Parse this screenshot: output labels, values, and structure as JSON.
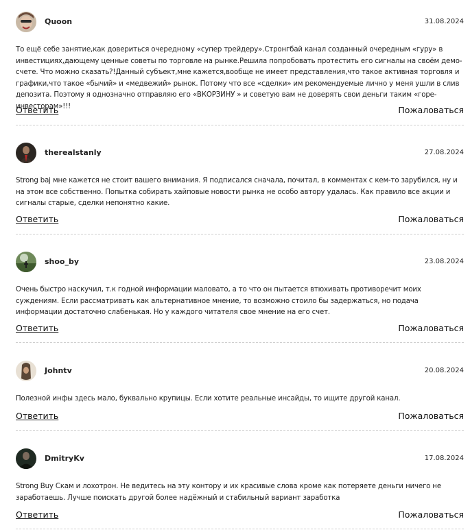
{
  "comments": [
    {
      "author": "Quoon",
      "date": "31.08.2024",
      "avatar": "user-avatar",
      "text": "То ещё себе занятие,как довериться очередному «супер трейдеру».Стронгбай канал созданный очередным «гуру» в инвестициях,дающему ценные советы по торговле на рынке.Решила попробовать протестить его сигналы на своём демо-счете. Что можно сказать?!Данный субъект,мне кажется,вообще не имеет представления,что такое активная торговля и графики,что такое «бычий» и «медвежий» рынок. Потому что все «сделки» им рекомендуемые лично у меня ушли в слив депозита. Поэтому я однозначно отправляю его «ВКОРЗИНУ » и советую вам не доверять свои деньги таким «горе-инвесторам»!!!",
      "reply_label": "Ответить",
      "report_label": "Пожаловаться"
    },
    {
      "author": "therealstanly",
      "date": "27.08.2024",
      "avatar": "user-avatar",
      "text": "Strong baj мне кажется не стоит вашего внимания. Я подписался сначала, почитал, в комментах с кем-то зарубился, ну и на этом все собственно. Попытка собирать хайповые новости рынка не особо автору удалась. Как правило все акции и сигналы старые, сделки непонятно какие.",
      "reply_label": "Ответить",
      "report_label": "Пожаловаться"
    },
    {
      "author": "shoo_by",
      "date": "23.08.2024",
      "avatar": "user-avatar",
      "text": "Очень быстро наскучил, т.к годной информации маловато, а то что он пытается втюхивать противоречит моих суждениям. Если рассматривать как альтернативное мнение, то возможно стоило бы задержаться, но подача информации достаточно слабенькая. Но у каждого читателя свое мнение на его счет.",
      "reply_label": "Ответить",
      "report_label": "Пожаловаться"
    },
    {
      "author": "Johntv",
      "date": "20.08.2024",
      "avatar": "user-avatar",
      "text": "Полезной инфы здесь мало, буквально крупицы. Если хотите реальные инсайды, то ищите другой канал.",
      "reply_label": "Ответить",
      "report_label": "Пожаловаться"
    },
    {
      "author": "DmitryKv",
      "date": "17.08.2024",
      "avatar": "user-avatar",
      "text": "Strong Buy Скам и лохотрон. Не ведитесь на эту контору и их красивые слова кроме как потеряете деньги ничего не заработаешь. Лучше поискать другой более надёжный и стабильный вариант заработка",
      "reply_label": "Ответить",
      "report_label": "Пожаловаться"
    }
  ]
}
